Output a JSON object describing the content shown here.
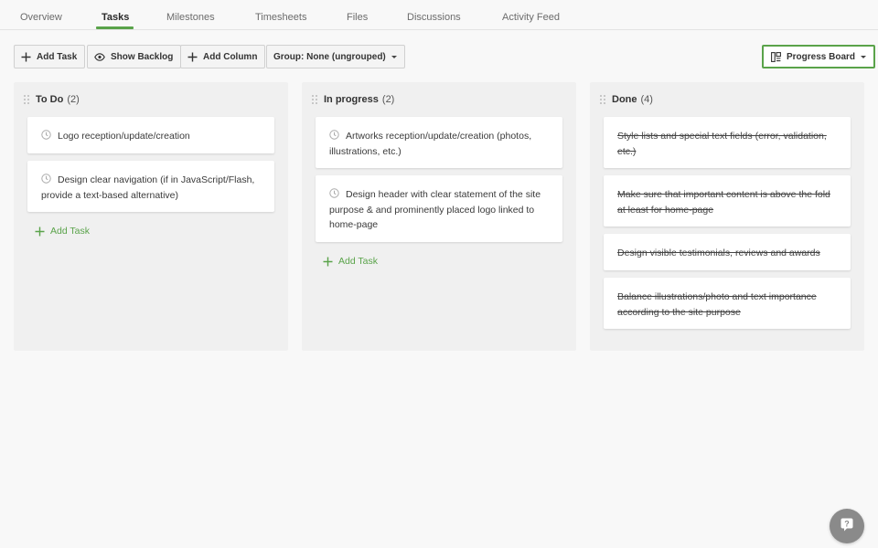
{
  "tabs": [
    {
      "label": "Overview",
      "active": false
    },
    {
      "label": "Tasks",
      "active": true
    },
    {
      "label": "Milestones",
      "active": false
    },
    {
      "label": "Timesheets",
      "active": false
    },
    {
      "label": "Files",
      "active": false
    },
    {
      "label": "Discussions",
      "active": false
    },
    {
      "label": "Activity Feed",
      "active": false
    }
  ],
  "toolbar": {
    "add_task": "Add Task",
    "show_backlog": "Show Backlog",
    "add_column": "Add Column",
    "group": "Group: None (ungrouped)",
    "view": "Progress Board"
  },
  "columns": [
    {
      "title": "To Do",
      "count": "(2)",
      "cards": [
        {
          "text": "Logo reception/update/creation"
        },
        {
          "text": "Design clear navigation (if in JavaScript/Flash, provide a text-based alternative)"
        }
      ],
      "add_label": "Add Task"
    },
    {
      "title": "In progress",
      "count": "(2)",
      "cards": [
        {
          "text": "Artworks reception/update/creation (photos, illustrations, etc.)"
        },
        {
          "text": "Design header with clear statement of the site purpose & and prominently placed logo linked to home-page"
        }
      ],
      "add_label": "Add Task"
    },
    {
      "title": "Done",
      "count": "(4)",
      "cards": [
        {
          "text": "Style lists and special text fields (error, validation, etc.)"
        },
        {
          "text": "Make sure that important content is above the fold at least for home-page"
        },
        {
          "text": "Design visible testimonials, reviews and awards"
        },
        {
          "text": "Balance illustrations/photo and text importance according to the site purpose"
        }
      ]
    }
  ],
  "colors": {
    "accent": "#5aa34a",
    "background": "#f8f8f8",
    "column": "#f0f0f0",
    "help_button": "#8a8a8a"
  },
  "icons": {
    "add": "plus-icon",
    "backlog": "eye-icon",
    "view": "board-icon",
    "card": "clock-icon",
    "drag": "grip-icon",
    "help": "question-icon"
  }
}
